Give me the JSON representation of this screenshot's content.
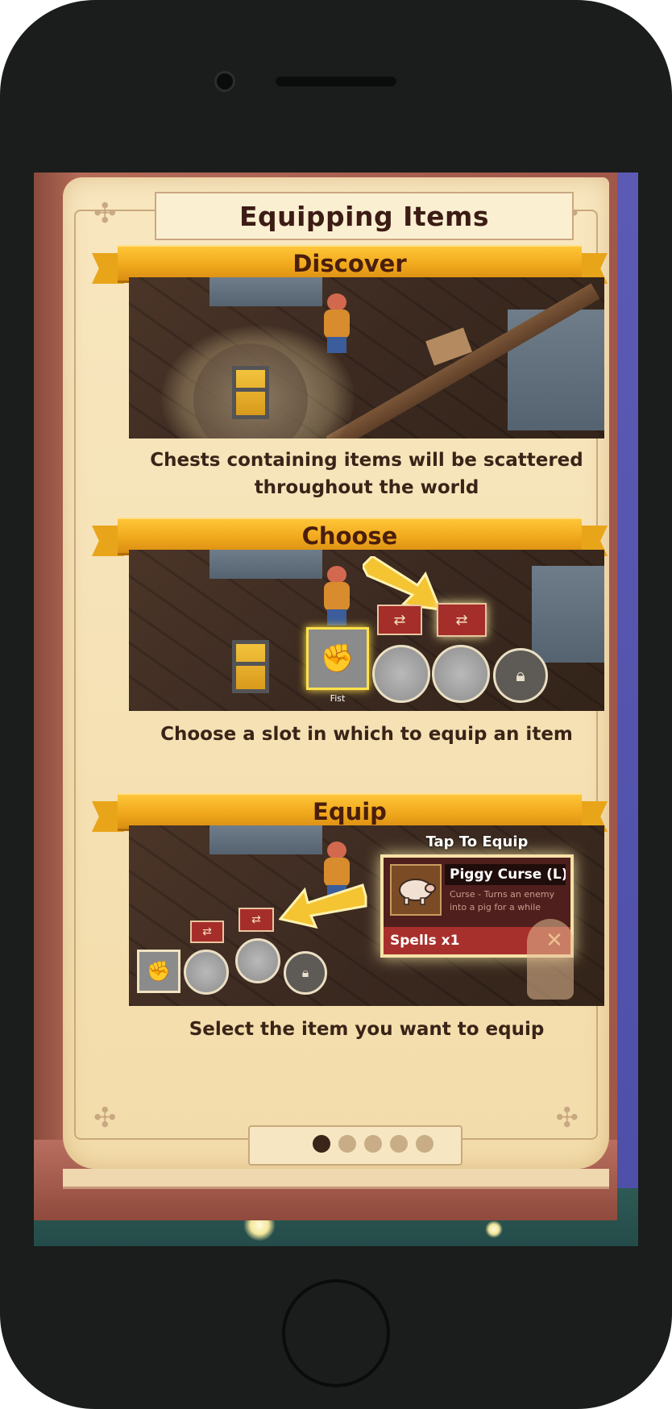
{
  "app": {
    "title": "Equipping Items"
  },
  "sections": [
    {
      "heading": "Discover",
      "caption_line1": "Chests containing items will be scattered",
      "caption_line2": "throughout the world"
    },
    {
      "heading": "Choose",
      "caption_line1": "Choose a slot in which to equip an item",
      "slot_label": "Fist"
    },
    {
      "heading": "Equip",
      "caption_line1": "Select the item you want to equip"
    }
  ],
  "popup": {
    "title": "Tap To Equip",
    "item_name": "Piggy Curse (L)",
    "item_desc": "Curse - Turns an enemy into a pig for a while",
    "category": "Spells x1",
    "close_icon": "close-icon"
  },
  "pagination": {
    "current_page": 1,
    "total_pages": 5
  },
  "colors": {
    "ribbon": "#f0a81c",
    "page": "#f6e3b8",
    "title_text": "#3c1c14",
    "accent_red": "#a8302c"
  },
  "icons": [
    "fist-icon",
    "swap-icon",
    "lock-icon",
    "pig-icon",
    "close-icon",
    "arrow-icon",
    "chest-icon",
    "celtic-knot-icon"
  ]
}
